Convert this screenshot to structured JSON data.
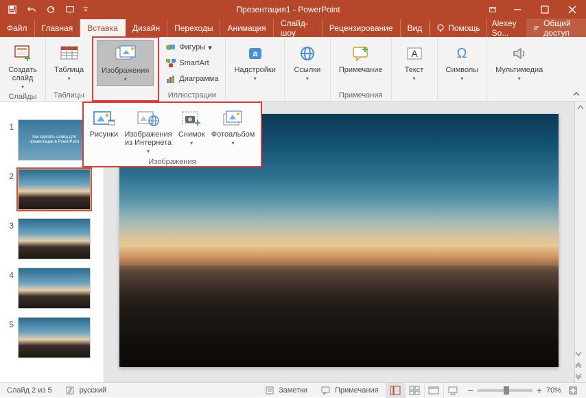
{
  "app": {
    "title": "Презентация1 - PowerPoint"
  },
  "tabs": {
    "file": "Файл",
    "home": "Главная",
    "insert": "Вставка",
    "design": "Дизайн",
    "transitions": "Переходы",
    "animation": "Анимация",
    "slideshow": "Слайд-шоу",
    "review": "Рецензирование",
    "view": "Вид",
    "help": "Помощь",
    "account": "Alexey So...",
    "share": "Общий доступ"
  },
  "ribbon": {
    "groups": {
      "slides": {
        "label": "Слайды",
        "new_slide": "Создать\nслайд"
      },
      "tables": {
        "label": "Таблицы",
        "table": "Таблица"
      },
      "images": {
        "label": "Изображения",
        "button": "Изображения"
      },
      "illustrations": {
        "label": "Иллюстрации",
        "shapes": "Фигуры",
        "smartart": "SmartArt",
        "chart": "Диаграмма"
      },
      "addins": {
        "label": "",
        "button": "Надстройки"
      },
      "links": {
        "label": "",
        "button": "Ссылки"
      },
      "comments": {
        "label": "Примечания",
        "button": "Примечание"
      },
      "text": {
        "label": "",
        "button": "Текст"
      },
      "symbols": {
        "label": "",
        "button": "Символы"
      },
      "media": {
        "label": "",
        "button": "Мультимедиа"
      }
    }
  },
  "gallery": {
    "label": "Изображения",
    "items": {
      "pictures": "Рисунки",
      "online": "Изображения\nиз Интернета",
      "screenshot": "Снимок",
      "album": "Фотоальбом"
    }
  },
  "thumbnails": {
    "slide1_caption": "Как сделать слайд для презентации в PowerPoint",
    "items": [
      "1",
      "2",
      "3",
      "4",
      "5"
    ],
    "selected_index": 1
  },
  "status": {
    "slide_of": "Слайд 2 из 5",
    "language": "русский",
    "notes": "Заметки",
    "comments": "Примечания",
    "zoom_pct": "70%"
  },
  "colors": {
    "accent": "#b7472a",
    "highlight": "#e53935"
  }
}
